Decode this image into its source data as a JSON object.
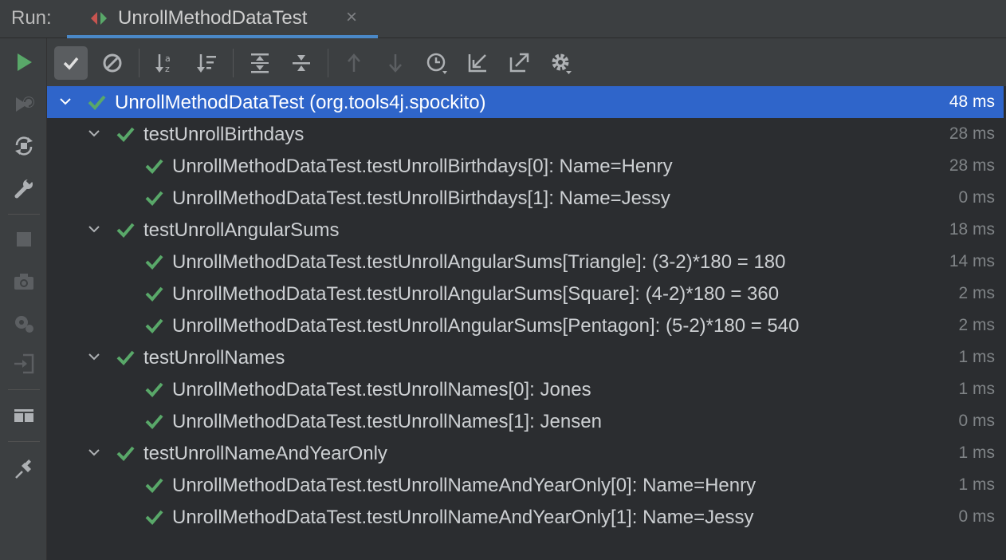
{
  "run_bar": {
    "label": "Run:",
    "tab_title": "UnrollMethodDataTest",
    "close_glyph": "×"
  },
  "gutter_icons": [
    "run-icon",
    "rerun-failed-icon",
    "toggle-auto-test-icon",
    "wrench-icon",
    "stop-icon",
    "camera-icon",
    "debug-settings-icon",
    "import-icon",
    "layout-icon",
    "pin-icon"
  ],
  "toolbar_icons": [
    "show-passed-icon",
    "show-ignored-icon",
    "sort-alphabetically-icon",
    "sort-by-duration-icon",
    "expand-all-icon",
    "collapse-all-icon",
    "previous-failed-icon",
    "next-failed-icon",
    "test-history-icon",
    "import-tests-icon",
    "export-tests-icon",
    "settings-icon"
  ],
  "colors": {
    "accent": "#4a88c7",
    "selection": "#2f65ca",
    "success": "#59a869"
  },
  "tree": [
    {
      "label": "UnrollMethodDataTest (org.tools4j.spockito)",
      "time": "48 ms"
    },
    {
      "label": "testUnrollBirthdays",
      "time": "28 ms"
    },
    {
      "label": "UnrollMethodDataTest.testUnrollBirthdays[0]: Name=Henry",
      "time": "28 ms"
    },
    {
      "label": "UnrollMethodDataTest.testUnrollBirthdays[1]: Name=Jessy",
      "time": "0 ms"
    },
    {
      "label": "testUnrollAngularSums",
      "time": "18 ms"
    },
    {
      "label": "UnrollMethodDataTest.testUnrollAngularSums[Triangle]: (3-2)*180 = 180",
      "time": "14 ms"
    },
    {
      "label": "UnrollMethodDataTest.testUnrollAngularSums[Square]: (4-2)*180 = 360",
      "time": "2 ms"
    },
    {
      "label": "UnrollMethodDataTest.testUnrollAngularSums[Pentagon]: (5-2)*180 = 540",
      "time": "2 ms"
    },
    {
      "label": "testUnrollNames",
      "time": "1 ms"
    },
    {
      "label": "UnrollMethodDataTest.testUnrollNames[0]: Jones",
      "time": "1 ms"
    },
    {
      "label": "UnrollMethodDataTest.testUnrollNames[1]: Jensen",
      "time": "0 ms"
    },
    {
      "label": "testUnrollNameAndYearOnly",
      "time": "1 ms"
    },
    {
      "label": "UnrollMethodDataTest.testUnrollNameAndYearOnly[0]: Name=Henry",
      "time": "1 ms"
    },
    {
      "label": "UnrollMethodDataTest.testUnrollNameAndYearOnly[1]: Name=Jessy",
      "time": "0 ms"
    }
  ]
}
